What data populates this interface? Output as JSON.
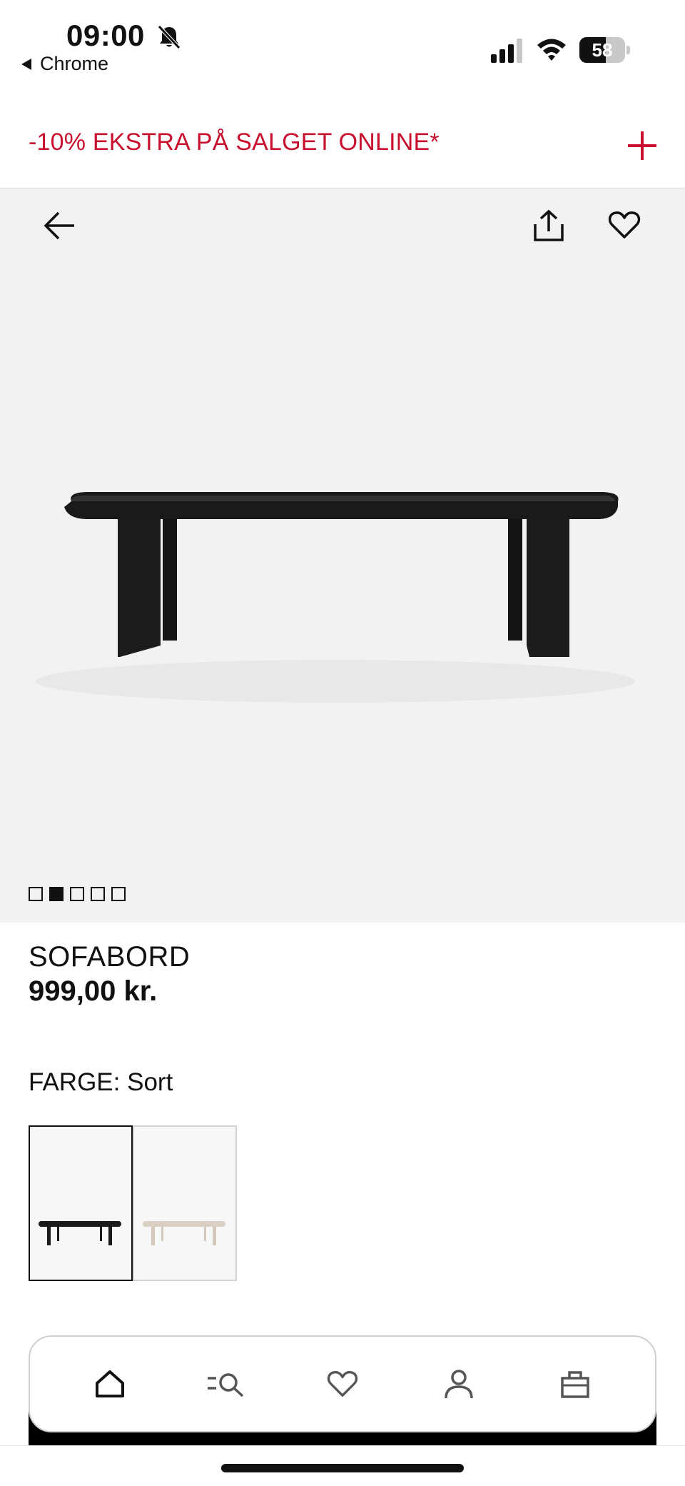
{
  "status_bar": {
    "time": "09:00",
    "back_app": "Chrome",
    "battery": "58",
    "battery_level_percent": 58,
    "icons": [
      "bell-slash-icon",
      "signal-icon",
      "wifi-icon",
      "battery-icon"
    ]
  },
  "promo": {
    "text": "-10% EKSTRA PÅ SALGET ONLINE*",
    "color": "#c8102e",
    "expand_icon": "plus-icon"
  },
  "gallery": {
    "background": "#f2f2f2",
    "icons": [
      "back-arrow-icon",
      "share-icon",
      "heart-icon"
    ],
    "image": "black oval coffee table",
    "slide_count": 5,
    "active_slide": 2
  },
  "product": {
    "name": "SOFABORD",
    "price": "999,00 kr.",
    "color_label": "FARGE:",
    "color_value": "Sort",
    "swatches": [
      {
        "name": "black-table",
        "selected": true,
        "color": "#1a1a1a"
      },
      {
        "name": "beige-table",
        "selected": false,
        "color": "#d9cfc2"
      }
    ]
  },
  "bottom_nav": {
    "items": [
      "home-icon",
      "search-menu-icon",
      "heart-icon",
      "account-icon",
      "bag-icon"
    ]
  }
}
